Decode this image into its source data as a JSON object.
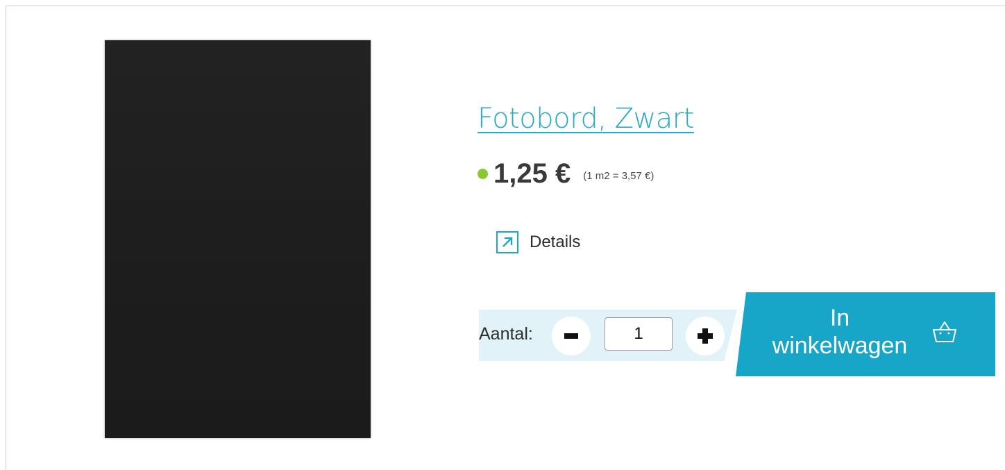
{
  "product": {
    "title": "Fotobord, Zwart",
    "image_icon": "black-board-photo",
    "stock_color": "#8ac832",
    "price": "1,25 €",
    "unit_price": "(1 m2 = 3,57 €)"
  },
  "details": {
    "label": "Details",
    "icon": "external-arrow-icon"
  },
  "quantity": {
    "label": "Aantal:",
    "value": "1",
    "decrement_icon": "minus-icon",
    "increment_icon": "plus-icon"
  },
  "cart": {
    "label": "In\nwinkelwagen",
    "icon": "basket-icon"
  },
  "colors": {
    "accent": "#17a6c8",
    "qty_background": "#e1f3f8",
    "text": "#2e2e2e"
  }
}
